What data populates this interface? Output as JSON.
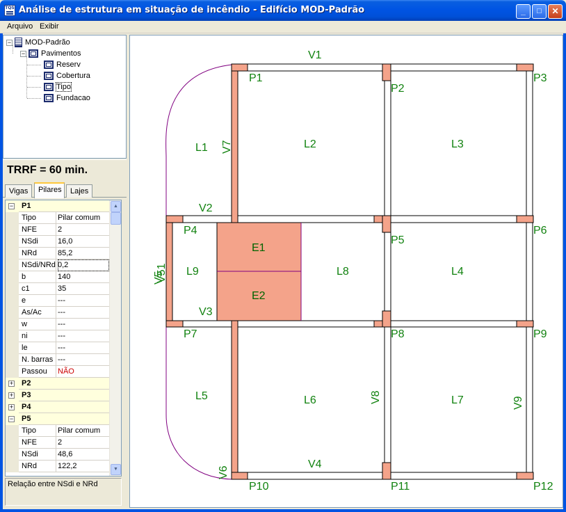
{
  "window": {
    "title": "Análise de estrutura em situação de incêndio - Edifício MOD-Padrão",
    "app_icon_text": "TQS",
    "minimize": "_",
    "maximize": "□",
    "close": "✕"
  },
  "menu": {
    "file": "Arquivo",
    "view": "Exibir"
  },
  "tree": {
    "root": "MOD-Padrão",
    "floors_group": "Pavimentos",
    "floors": [
      "Reserv",
      "Cobertura",
      "Tipo",
      "Fundacao"
    ],
    "selected": "Tipo"
  },
  "trrf": "TRRF = 60 min.",
  "tabs": [
    "Vigas",
    "Pilares",
    "Lajes"
  ],
  "active_tab": "Pilares",
  "grid": {
    "p1": {
      "name": "P1",
      "rows": [
        {
          "k": "Tipo",
          "v": "Pilar comum"
        },
        {
          "k": "NFE",
          "v": "2"
        },
        {
          "k": "NSdi",
          "v": "16,0"
        },
        {
          "k": "NRd",
          "v": "85,2"
        },
        {
          "k": "NSdi/NRd",
          "v": "0,2"
        },
        {
          "k": "b",
          "v": "140"
        },
        {
          "k": "c1",
          "v": "35"
        },
        {
          "k": "e",
          "v": "---"
        },
        {
          "k": "As/Ac",
          "v": "---"
        },
        {
          "k": "w",
          "v": "---"
        },
        {
          "k": "ni",
          "v": "---"
        },
        {
          "k": "le",
          "v": "---"
        },
        {
          "k": "N. barras",
          "v": "---"
        },
        {
          "k": "Passou",
          "v": "NÃO"
        }
      ]
    },
    "collapsed": [
      "P2",
      "P3",
      "P4"
    ],
    "p5": {
      "name": "P5",
      "rows": [
        {
          "k": "Tipo",
          "v": "Pilar comum"
        },
        {
          "k": "NFE",
          "v": "2"
        },
        {
          "k": "NSdi",
          "v": "48,6"
        },
        {
          "k": "NRd",
          "v": "122,2"
        }
      ]
    },
    "expand_symbol": "+",
    "collapse_symbol": "−",
    "scroll_up": "▲",
    "scroll_down": "▼"
  },
  "status": "Relação entre NSdi e NRd",
  "plan": {
    "beams": {
      "v1": "V1",
      "v2": "V2",
      "v3": "V3",
      "v4": "V4",
      "v5": "V5",
      "v6": "V6",
      "v7": "V7",
      "v8": "V8",
      "v9": "V9",
      "v51": "V51"
    },
    "pillars": {
      "p1": "P1",
      "p2": "P2",
      "p3": "P3",
      "p4": "P4",
      "p5": "P5",
      "p6": "P6",
      "p7": "P7",
      "p8": "P8",
      "p9": "P9",
      "p10": "P10",
      "p11": "P11",
      "p12": "P12"
    },
    "slabs": {
      "l1": "L1",
      "l2": "L2",
      "l3": "L3",
      "l4": "L4",
      "l5": "L5",
      "l6": "L6",
      "l7": "L7",
      "l8": "L8",
      "l9": "L9"
    },
    "stairs": {
      "e1": "E1",
      "e2": "E2"
    },
    "colors": {
      "failed_element": "#f4a38a",
      "label": "#11820f",
      "outline": "#000000",
      "curve": "#800080"
    }
  }
}
